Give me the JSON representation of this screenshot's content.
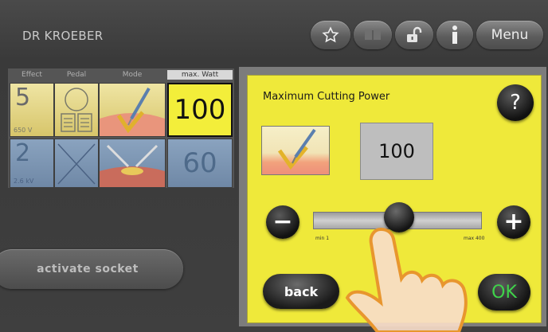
{
  "header": {
    "brand": "DR KROEBER",
    "icons": [
      "star-icon",
      "book-icon",
      "unlock-icon",
      "info-icon"
    ],
    "menu_label": "Menu"
  },
  "effect_table": {
    "columns": [
      "Effect",
      "Pedal",
      "Mode",
      "max. Watt"
    ],
    "active_column": "max. Watt",
    "rows": [
      {
        "effect": "5",
        "voltage": "650 V",
        "pedal": "pedal-icon",
        "mode": "cutting-mode-icon",
        "watt": "100",
        "color": "yellow"
      },
      {
        "effect": "2",
        "voltage": "2.6 kV",
        "pedal": "cross-icon",
        "mode": "coag-mode-icon",
        "watt": "60",
        "color": "blue"
      }
    ]
  },
  "socket": {
    "label": "activate socket"
  },
  "dialog": {
    "title": "Maximum Cutting Power",
    "help_label": "?",
    "value": "100",
    "slider": {
      "min_label": "min 1",
      "max_label": "max 400",
      "min": 1,
      "max": 400,
      "value": 100
    },
    "minus_label": "−",
    "plus_label": "+",
    "back_label": "back",
    "ok_label": "OK",
    "background_color": "#efe93a",
    "ok_color": "#3fd34a"
  }
}
